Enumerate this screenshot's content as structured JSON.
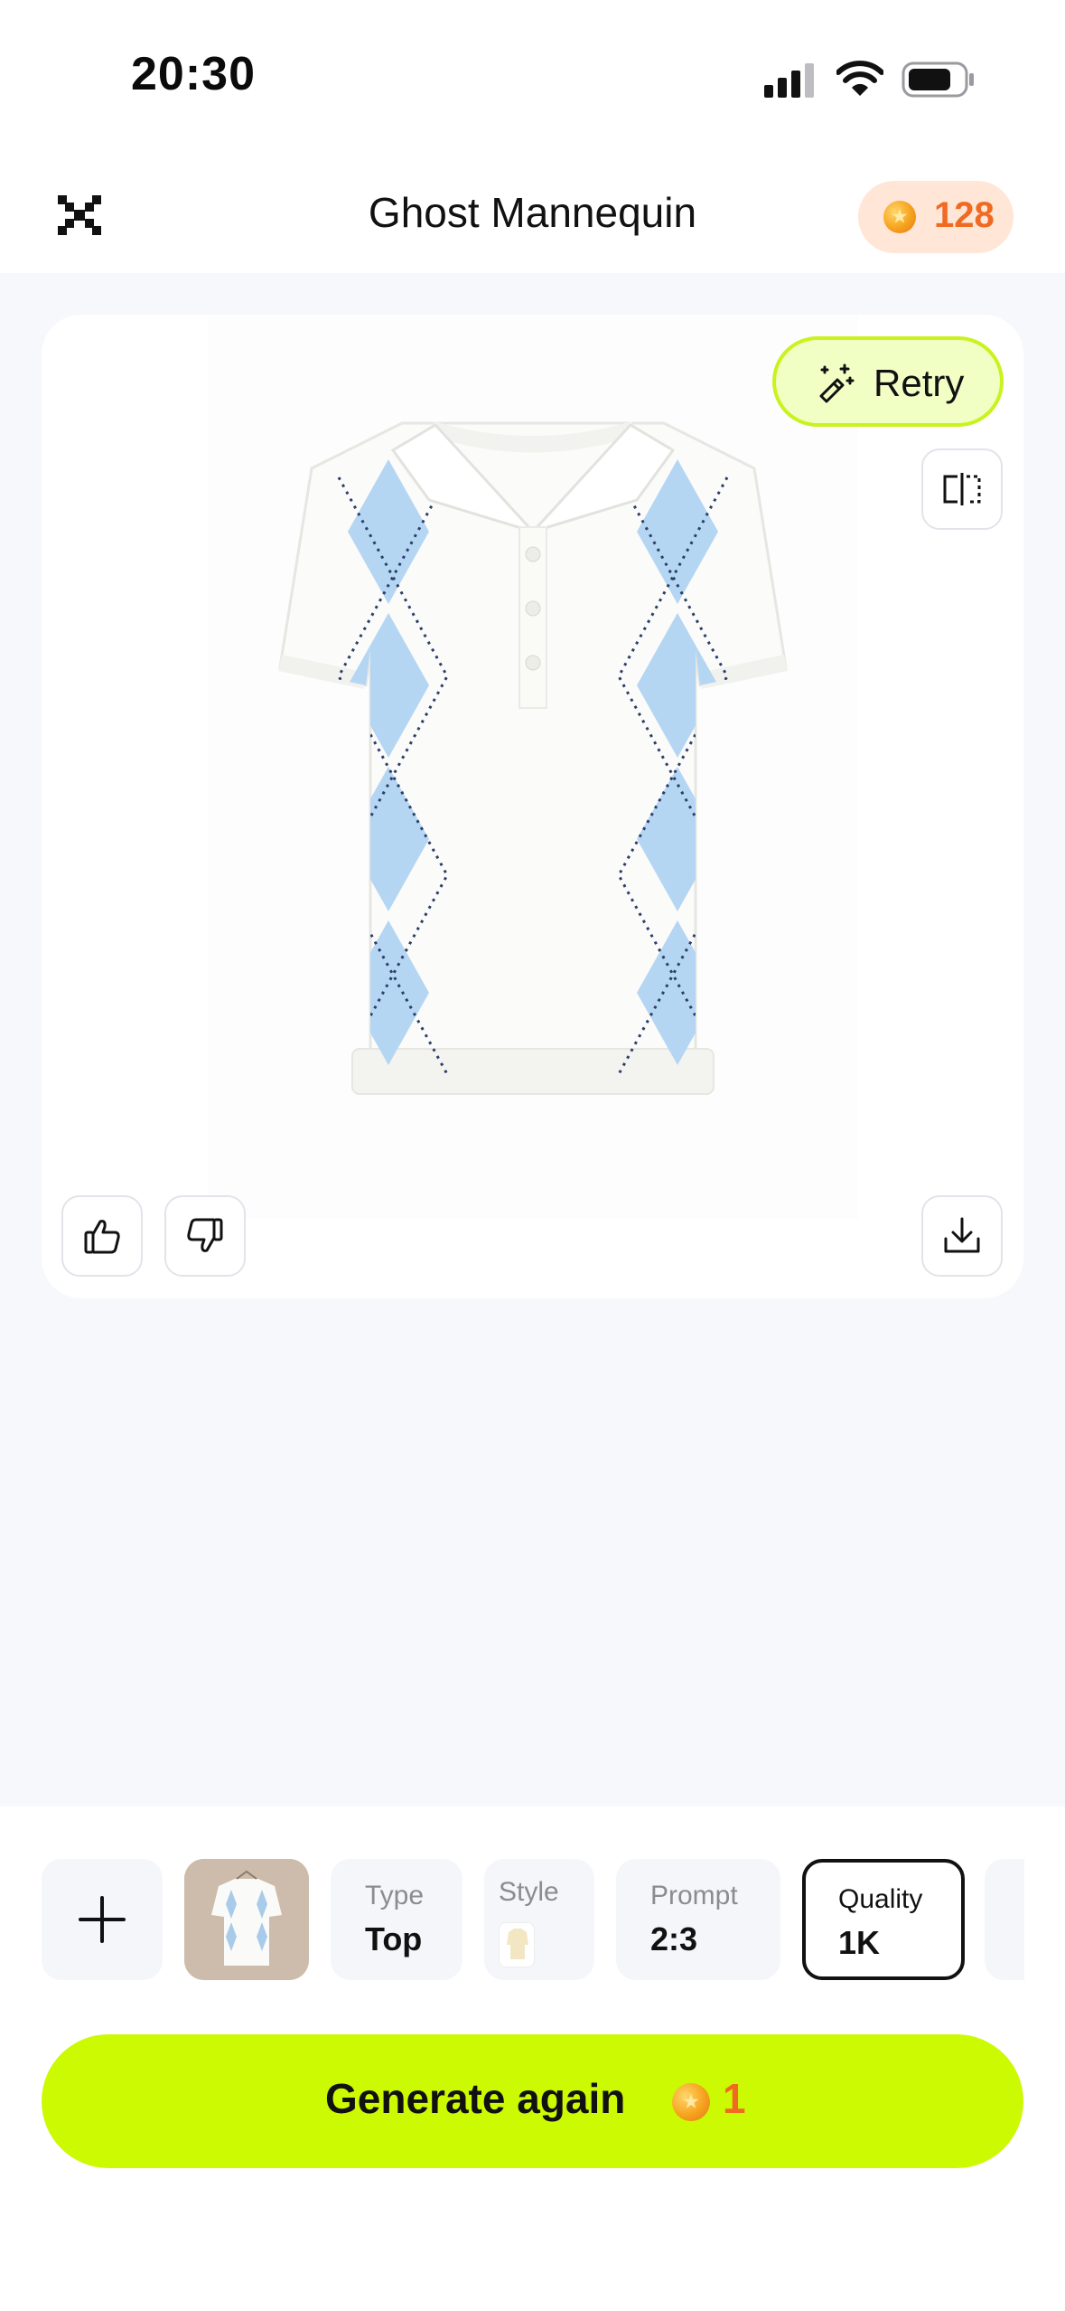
{
  "status_bar": {
    "time": "20:30"
  },
  "header": {
    "title": "Ghost Mannequin",
    "coin_balance": "128"
  },
  "result": {
    "retry_label": "Retry",
    "image_alt": "White short-sleeve polo sweater with light blue argyle pattern"
  },
  "options": [
    {
      "key": "Type",
      "value": "Top"
    },
    {
      "key": "Style",
      "value": ""
    },
    {
      "key": "Prompt",
      "value": "2:3"
    },
    {
      "key": "Quality",
      "value": "1K"
    }
  ],
  "action": {
    "label": "Generate again",
    "cost": "1"
  },
  "colors": {
    "accent": "#CCFA02",
    "coin_text": "#F06A22",
    "retry_bg": "#F1FFC5"
  },
  "icons": [
    "close-icon",
    "coin-icon",
    "retry-wand-icon",
    "compare-icon",
    "thumbs-up-icon",
    "thumbs-down-icon",
    "download-icon",
    "plus-icon"
  ]
}
